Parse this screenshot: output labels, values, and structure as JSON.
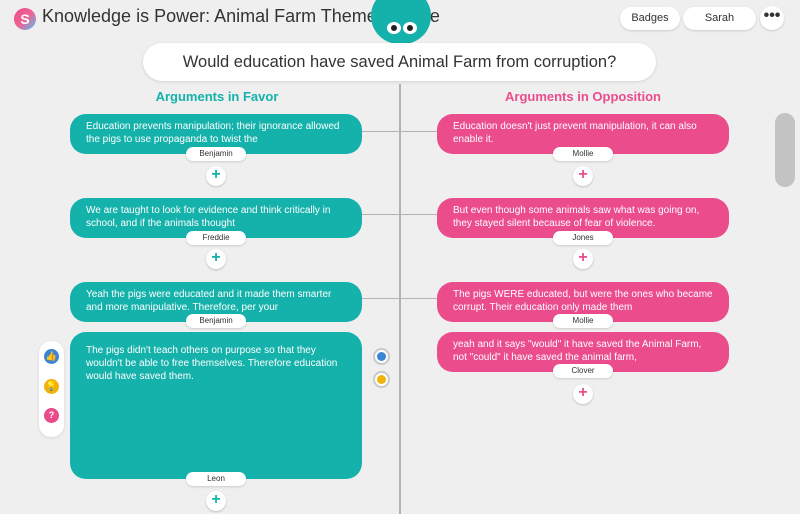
{
  "app": {
    "logo_letter": "S",
    "title": "Knowledge is Power: Animal Farm Theme Debate",
    "badges_label": "Badges",
    "user_label": "Sarah",
    "more_label": "•••"
  },
  "question": "Would education have saved Animal Farm from corruption?",
  "columns": {
    "favor_title": "Arguments in Favor",
    "opposition_title": "Arguments in Opposition"
  },
  "colors": {
    "favor": "#14b2ab",
    "opposition": "#ea4c8c",
    "favor_heading": "#14b2ab",
    "opposition_heading": "#ea4c8c"
  },
  "favor_cards": [
    {
      "text": "Education prevents manipulation; their ignorance allowed the pigs to use propaganda to twist the",
      "author": "Benjamin"
    },
    {
      "text": "We are taught to look for evidence and think critically in school, and if the animals thought",
      "author": "Freddie"
    },
    {
      "text": "Yeah the pigs were educated and it made them smarter and more manipulative. Therefore, per your",
      "author": "Benjamin"
    },
    {
      "text": "The pigs didn't teach others on purpose so that they wouldn't be able to free themselves. Therefore education would have saved them.",
      "author": "Leon"
    }
  ],
  "opposition_cards": [
    {
      "text": "Education doesn't just prevent manipulation, it can also enable it.",
      "author": "Mollie"
    },
    {
      "text": "But even though some animals saw what was going on, they stayed silent because of fear of violence.",
      "author": "Jones"
    },
    {
      "text": "The pigs WERE educated, but were the ones who became corrupt. Their education only made them",
      "author": "Mollie"
    },
    {
      "text": "yeah and it says \"would\" it have saved the Animal Farm, not \"could\" it have saved the animal farm,",
      "author": "Clover"
    }
  ],
  "add_label": "+",
  "reaction_icons": [
    "thumbs-up-icon",
    "lightbulb-icon",
    "question-icon"
  ],
  "reaction_glyphs": {
    "thumbs": "👍",
    "bulb": "💡",
    "question": "?"
  }
}
